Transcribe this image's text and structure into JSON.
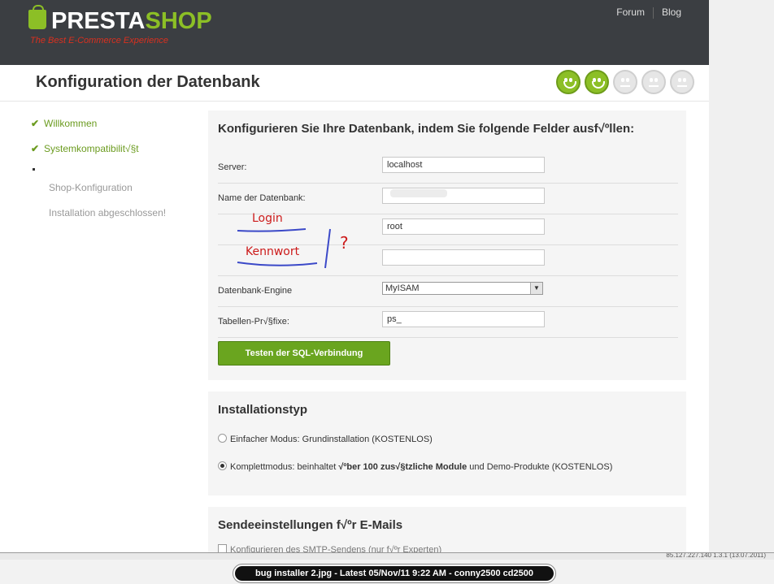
{
  "header": {
    "logo_text_main": "PRESTA",
    "logo_text_accent": "SHOP",
    "tagline": "The Best E-Commerce Experience",
    "links": [
      "Forum",
      "Blog"
    ]
  },
  "title": "Konfiguration der Datenbank",
  "progress": {
    "completed_steps": 2,
    "total_steps": 5
  },
  "sidebar": {
    "steps": [
      {
        "label": "Willkommen",
        "status": "done"
      },
      {
        "label": "Systemkompatibilit√§t",
        "status": "done"
      },
      {
        "label": "Shop-Konfiguration",
        "status": "todo"
      },
      {
        "label": "Installation abgeschlossen!",
        "status": "todo"
      }
    ]
  },
  "db_form": {
    "heading": "Konfigurieren Sie Ihre Datenbank, indem Sie folgende Felder ausf√ºllen:",
    "server_label": "Server:",
    "server_value": "localhost",
    "dbname_label": "Name der Datenbank:",
    "dbname_value": "",
    "login_value": "root",
    "password_value": "",
    "engine_label": "Datenbank-Engine",
    "engine_value": "MyISAM",
    "prefix_label": "Tabellen-Pr√§fixe:",
    "prefix_value": "ps_",
    "test_button": "Testen der SQL-Verbindung"
  },
  "annotations": {
    "login": "Login",
    "password": "Kennwort",
    "question": "?"
  },
  "install_type": {
    "heading": "Installationstyp",
    "simple_option": "Einfacher Modus: Grundinstallation (KOSTENLOS)",
    "full_option_prefix": "Komplettmodus: beinhaltet ",
    "full_option_bold": "√ºber 100 zus√§tzliche Module",
    "full_option_suffix": " und Demo-Produkte (KOSTENLOS)",
    "selected": "full"
  },
  "mail": {
    "heading": "Sendeeinstellungen f√ºr E-Mails",
    "smtp_label": "Konfigurieren des SMTP-Sendens (nur f√ºr Experten)"
  },
  "statusbar": {
    "text": "85.127.227.140   1.3.1 (13.07.2011)"
  },
  "caption": "bug installer 2.jpg - Latest 05/Nov/11 9:22 AM - conny2500 cd2500",
  "colors": {
    "accent_green": "#8cbf26",
    "header_dark": "#3b3e42",
    "annotation_red": "#cc1a1a"
  }
}
